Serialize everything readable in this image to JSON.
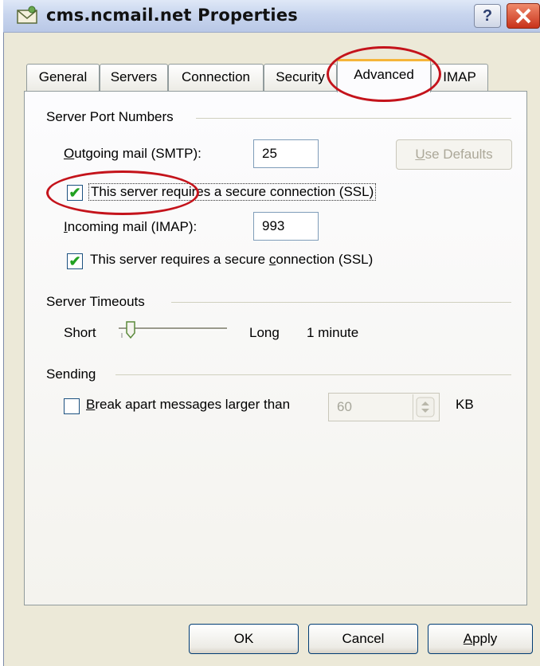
{
  "window": {
    "title": "cms.ncmail.net Properties",
    "help_label": "?"
  },
  "tabs": [
    {
      "label": "General"
    },
    {
      "label": "Servers"
    },
    {
      "label": "Connection"
    },
    {
      "label": "Security"
    },
    {
      "label": "Advanced",
      "selected": true
    },
    {
      "label": "IMAP"
    }
  ],
  "server_ports": {
    "group_label": "Server Port Numbers",
    "outgoing_label": "Outgoing mail (SMTP):",
    "outgoing_value": "25",
    "use_defaults_label": "Use Defaults",
    "outgoing_ssl_label": "This server requires a secure connection (SSL)",
    "outgoing_ssl_checked": true,
    "incoming_label": "Incoming mail (IMAP):",
    "incoming_value": "993",
    "incoming_ssl_label": "This server requires a secure connection (SSL)",
    "incoming_ssl_checked": true
  },
  "timeouts": {
    "group_label": "Server Timeouts",
    "short_label": "Short",
    "long_label": "Long",
    "value_label": "1 minute"
  },
  "sending": {
    "group_label": "Sending",
    "break_apart_label": "Break apart messages larger than",
    "break_apart_checked": false,
    "break_apart_value": "60",
    "unit_label": "KB"
  },
  "footer": {
    "ok_label": "OK",
    "cancel_label": "Cancel",
    "apply_label": "Apply"
  },
  "colors": {
    "annotation": "#c4131b",
    "check": "#21a121",
    "tab_highlight": "#f5b53a"
  }
}
